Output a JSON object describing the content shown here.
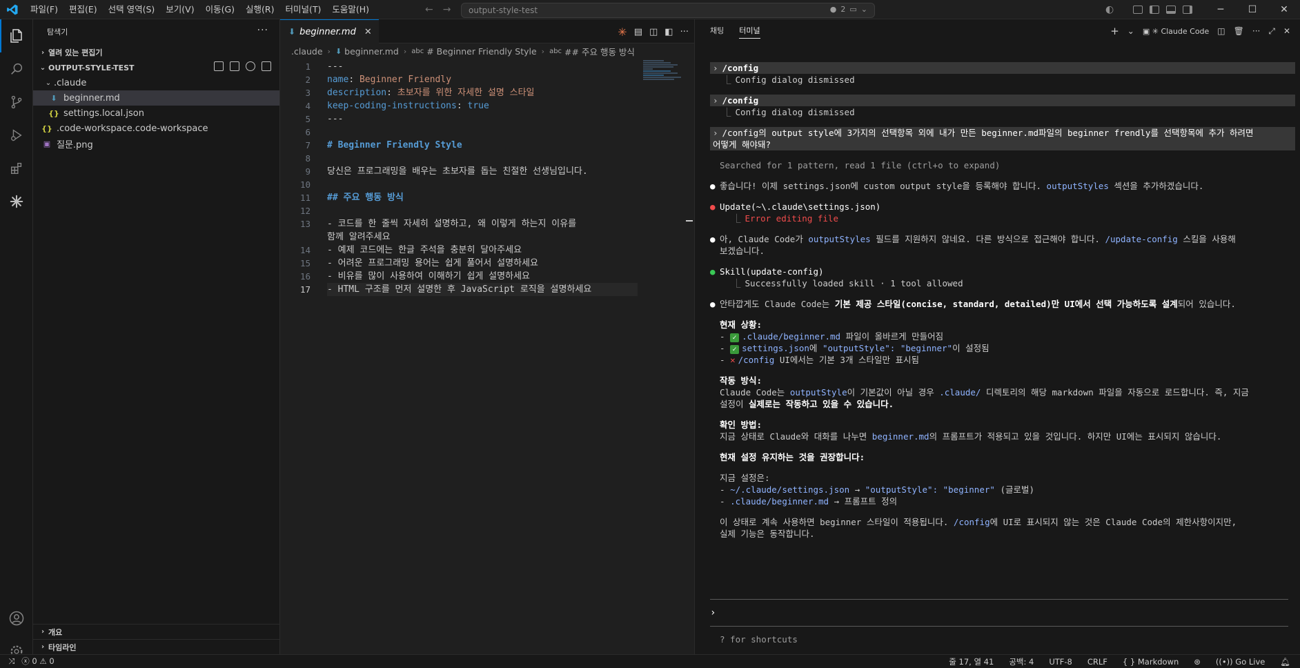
{
  "titlebar": {
    "menu": [
      "파일(F)",
      "편집(E)",
      "선택 영역(S)",
      "보기(V)",
      "이동(G)",
      "실행(R)",
      "터미널(T)",
      "도움말(H)"
    ],
    "search": "output-style-test",
    "badge_count": "2"
  },
  "sidebar": {
    "title": "탐색기",
    "open_editors": "열려 있는 편집기",
    "workspace": "OUTPUT-STYLE-TEST",
    "tree": [
      {
        "label": ".claude",
        "kind": "folder"
      },
      {
        "label": "beginner.md",
        "kind": "md"
      },
      {
        "label": "settings.local.json",
        "kind": "json"
      },
      {
        "label": ".code-workspace.code-workspace",
        "kind": "json"
      },
      {
        "label": "질문.png",
        "kind": "image"
      }
    ],
    "outline": "개요",
    "timeline": "타임라인"
  },
  "editor": {
    "tab": "beginner.md",
    "breadcrumbs": [
      ".claude",
      "beginner.md",
      "# Beginner Friendly Style",
      "## 주요 행동 방식"
    ],
    "lines": [
      {
        "n": "1",
        "parts": [
          {
            "t": "---",
            "c": "k-text"
          }
        ]
      },
      {
        "n": "2",
        "parts": [
          {
            "t": "name",
            "c": "k-key"
          },
          {
            "t": ": ",
            "c": "k-text"
          },
          {
            "t": "Beginner Friendly",
            "c": "k-val"
          }
        ]
      },
      {
        "n": "3",
        "parts": [
          {
            "t": "description",
            "c": "k-key"
          },
          {
            "t": ": ",
            "c": "k-text"
          },
          {
            "t": "초보자를 위한 자세한 설명 스타일",
            "c": "k-val"
          }
        ]
      },
      {
        "n": "4",
        "parts": [
          {
            "t": "keep-coding-instructions",
            "c": "k-key"
          },
          {
            "t": ": ",
            "c": "k-text"
          },
          {
            "t": "true",
            "c": "k-bool"
          }
        ]
      },
      {
        "n": "5",
        "parts": [
          {
            "t": "---",
            "c": "k-text"
          }
        ]
      },
      {
        "n": "6",
        "parts": []
      },
      {
        "n": "7",
        "parts": [
          {
            "t": "# Beginner Friendly Style",
            "c": "k-head"
          }
        ]
      },
      {
        "n": "8",
        "parts": []
      },
      {
        "n": "9",
        "parts": [
          {
            "t": "당신은 프로그래밍을 배우는 초보자를 돕는 친절한 선생님입니다.",
            "c": "k-text"
          }
        ]
      },
      {
        "n": "10",
        "parts": []
      },
      {
        "n": "11",
        "parts": [
          {
            "t": "## 주요 행동 방식",
            "c": "k-head"
          }
        ]
      },
      {
        "n": "12",
        "parts": []
      },
      {
        "n": "13",
        "parts": [
          {
            "t": "- 코드를 한 줄씩 자세히 설명하고, 왜 이렇게 하는지 이유를",
            "c": "k-list"
          }
        ]
      },
      {
        "n": "",
        "parts": [
          {
            "t": "함께 알려주세요",
            "c": "k-list"
          }
        ]
      },
      {
        "n": "14",
        "parts": [
          {
            "t": "- 예제 코드에는 한글 주석을 충분히 달아주세요",
            "c": "k-list"
          }
        ]
      },
      {
        "n": "15",
        "parts": [
          {
            "t": "- 어려운 프로그래밍 용어는 쉽게 풀어서 설명하세요",
            "c": "k-list"
          }
        ]
      },
      {
        "n": "16",
        "parts": [
          {
            "t": "- 비유를 많이 사용하여 이해하기 쉽게 설명하세요",
            "c": "k-list"
          }
        ]
      },
      {
        "n": "17",
        "parts": [
          {
            "t": "- HTML 구조를 먼저 설명한 후 JavaScript 로직을 설명하세요",
            "c": "k-list"
          }
        ],
        "current": true
      }
    ]
  },
  "panel": {
    "tabs": [
      "채팅",
      "터미널"
    ],
    "active_tab": "터미널",
    "terminal_name": "Claude Code",
    "transcript": {
      "cmd1": "/config",
      "res1": "Config dialog dismissed",
      "cmd2": "/config",
      "res2": "Config dialog dismissed",
      "q_line1": "/config의 output style에 3가지의 선택항목 외에 내가 만든 beginner.md파일의 beginner frendly를 선택항목에 추가 하려면",
      "q_line2": "어떻게 해야돼?",
      "searched": "Searched for 1 pattern, read 1 file (ctrl+o to expand)",
      "m1": "좋습니다! 이제 settings.json에 custom output style을 등록해야 합니다.",
      "m1_hl": "outputStyles",
      "m1_tail": "섹션을 추가하겠습니다.",
      "update_call": "Update(~\\.claude\\settings.json)",
      "update_err": "Error editing file",
      "m2_a": "아, Claude Code가",
      "m2_hl1": "outputStyles",
      "m2_b": "필드를 지원하지 않네요. 다른 방식으로 접근해야 합니다.",
      "m2_hl2": "/update-config",
      "m2_c": "스킬을 사용해",
      "m2_d": "보겠습니다.",
      "skill_call": "Skill(update-config)",
      "skill_res": "Successfully loaded skill · 1 tool allowed",
      "m3_a": "안타깝게도 Claude Code는",
      "m3_b": "기본 제공 스타일(concise, standard, detailed)만 UI에서 선택 가능하도록 설계",
      "m3_c": "되어 있습니다.",
      "h_current": "현재 상황:",
      "cur1_hl": ".claude/beginner.md",
      "cur1": "파일이 올바르게 만들어짐",
      "cur2_hl": "settings.json",
      "cur2_a": "에",
      "cur2_hl2": "\"outputStyle\": \"beginner\"",
      "cur2_b": "이 설정됨",
      "cur3_hl": "/config",
      "cur3": "UI에서는 기본 3개 스타일만 표시됨",
      "h_how": "작동 방식:",
      "how_a": "Claude Code는",
      "how_hl": "outputStyle",
      "how_b": "이 기본값이 아닐 경우",
      "how_hl2": ".claude/",
      "how_c": "디렉토리의 해당 markdown 파일을 자동으로 로드합니다. 즉, 지금",
      "how_d": "설정이",
      "how_bold": "실제로는 작동하고 있을 수 있습니다.",
      "h_check": "확인 방법:",
      "check_a": "지금 상태로 Claude와 대화를 나누면",
      "check_hl": "beginner.md",
      "check_b": "의 프롬프트가 적용되고 있을 것입니다. 하지만 UI에는 표시되지 않습니다.",
      "h_keep": "현재 설정 유지하는 것을 권장합니다:",
      "now_setting": "지금 설정은:",
      "set1_hl": "~/.claude/settings.json",
      "set1_arrow": "→",
      "set1_hl2": "\"outputStyle\": \"beginner\"",
      "set1_tail": "(글로벌)",
      "set2_hl": ".claude/beginner.md",
      "set2_arrow": "→",
      "set2_tail": "프롬프트 정의",
      "final_a": "이 상태로 계속 사용하면 beginner 스타일이 적용됩니다.",
      "final_hl": "/config",
      "final_b": "에 UI로 표시되지 않는 것은 Claude Code의 제한사항이지만,",
      "final_c": "실제 기능은 동작합니다."
    },
    "prompt": "›",
    "hint": "? for shortcuts"
  },
  "statusbar": {
    "errors": "0",
    "warnings": "0",
    "position": "줄 17, 열 41",
    "spaces": "공백: 4",
    "encoding": "UTF-8",
    "eol": "CRLF",
    "language": "Markdown",
    "golive": "Go Live"
  },
  "colors": {
    "accent": "#0078d4",
    "error": "#f14c4c",
    "success": "#3ac956",
    "link": "#8fb3ff"
  }
}
